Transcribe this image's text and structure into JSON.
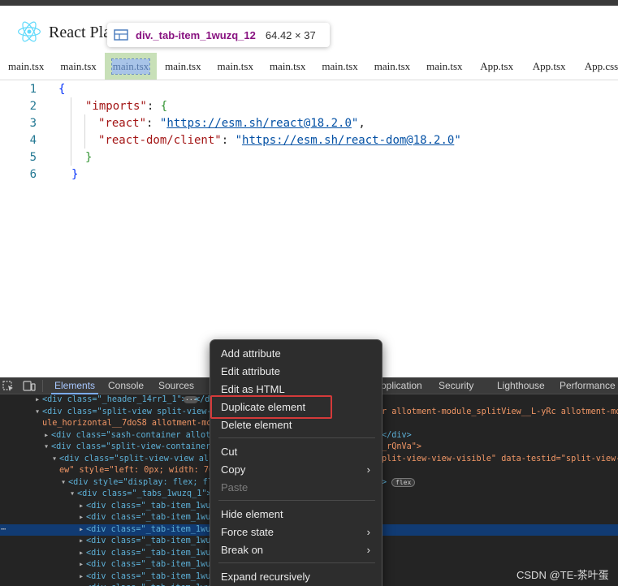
{
  "app": {
    "title": "React Pla"
  },
  "inspect_tooltip": {
    "selector": "div._tab-item_1wuzq_12",
    "size": "64.42 × 37"
  },
  "tabs": [
    {
      "label": "main.tsx"
    },
    {
      "label": "main.tsx"
    },
    {
      "label": "main.tsx"
    },
    {
      "label": "main.tsx"
    },
    {
      "label": "main.tsx"
    },
    {
      "label": "main.tsx"
    },
    {
      "label": "main.tsx"
    },
    {
      "label": "main.tsx"
    },
    {
      "label": "main.tsx"
    },
    {
      "label": "App.tsx"
    },
    {
      "label": "App.tsx"
    },
    {
      "label": "App.css"
    }
  ],
  "editor": {
    "line_numbers": [
      "1",
      "2",
      "3",
      "4",
      "5",
      "6"
    ],
    "open_brace": "{",
    "imports_key": "\"imports\"",
    "colon": ": ",
    "react_key": "\"react\"",
    "react_url": "https://esm.sh/react@18.2.0",
    "quote": "\"",
    "comma": ",",
    "react_dom_key": "\"react-dom/client\"",
    "react_dom_url": "https://esm.sh/react-dom@18.2.0",
    "close_brace": "}"
  },
  "devtools": {
    "tabs": {
      "elements": "Elements",
      "console": "Console",
      "sources": "Sources",
      "application": "pplication",
      "security": "Security",
      "lighthouse": "Lighthouse",
      "performance": "Performance i"
    },
    "tree": {
      "r0_a": "<div class=\"_header_14rr1_1\">",
      "r0_b": "</d",
      "r1_left": "<div class=\"split-view split-view-h",
      "r1_right": "r allotment-module_splitView__L-yRc allotment-mod",
      "r2_left": "ule_horizontal__7doS8 allotment-mod",
      "r3_left": "<div class=\"sash-container allotm",
      "r3_right": "</div>",
      "r4_left": "<div class=\"split-view-container",
      "r4_right": "_rQnVa\">",
      "r5_left": "<div class=\"split-view-view all",
      "r5_right": "plit-view-view-visible\" data-testid=\"split-view-v",
      "r6_left": "ew\" style=\"left: 0px; width: 76",
      "r7_left": "<div style=\"display: flex; fl",
      "r7_right": ">",
      "flex_badge": "flex",
      "r8_left": "<div class=\"_tabs_1wuzq_1\">",
      "tab_item_row": "<div class=\"_tab-item_1wuz",
      "row_ellipsis": "⋯"
    }
  },
  "context_menu": {
    "items": {
      "add_attribute": "Add attribute",
      "edit_attribute": "Edit attribute",
      "edit_as_html": "Edit as HTML",
      "duplicate_element": "Duplicate element",
      "delete_element": "Delete element",
      "cut": "Cut",
      "copy": "Copy",
      "paste": "Paste",
      "hide_element": "Hide element",
      "force_state": "Force state",
      "break_on": "Break on",
      "expand_recursively": "Expand recursively"
    },
    "submenu_arrow": "›"
  },
  "watermark": "CSDN @TE-茶叶蛋",
  "colors": {
    "accent_highlight": "#d43a3a",
    "react_logo": "#61dafb",
    "selected_row": "#113b73"
  }
}
